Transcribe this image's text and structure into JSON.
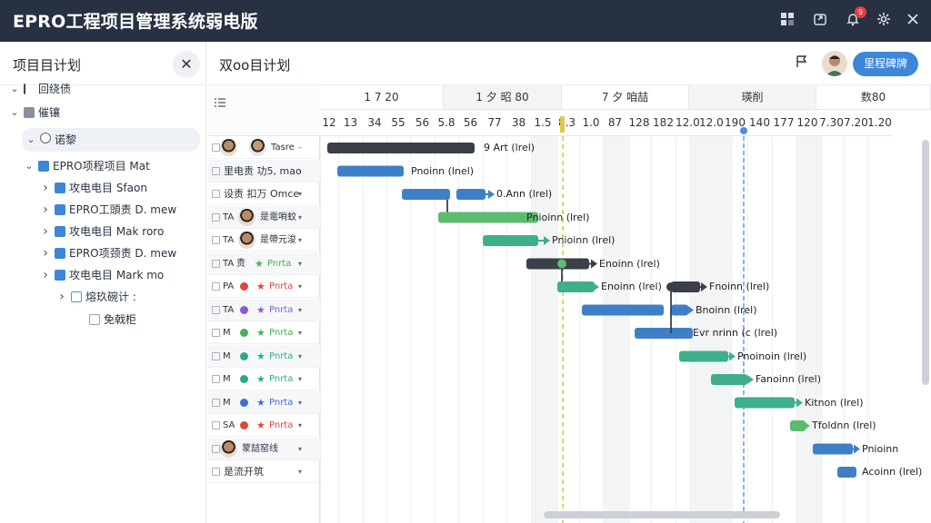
{
  "window": {
    "title": "EPRO工程项目管理系统弱电版",
    "icons": [
      "grid-icon",
      "share-icon",
      "bell-icon",
      "settings-icon",
      "close-icon"
    ],
    "notification_count": "9"
  },
  "left_panel": {
    "title": "项目目计划",
    "tree": [
      {
        "caret": "▾",
        "icon": "pin-icon",
        "label": "回绕债",
        "level": 0
      },
      {
        "caret": "▾",
        "icon": "square-icon",
        "label": "催镶",
        "level": 0
      },
      {
        "caret": "▾",
        "icon": "circle-icon",
        "label": "诺黎",
        "level": 1,
        "selected": true
      },
      {
        "caret": "▾",
        "icon": "project-icon",
        "label": "EPRO项程项目 Mat",
        "level": 2
      },
      {
        "caret": "›",
        "icon": "project-icon",
        "label": "攻电电目 Sfaon",
        "level": 3
      },
      {
        "caret": "›",
        "icon": "project-icon",
        "label": "EPRO工頭责 D. mew",
        "level": 3
      },
      {
        "caret": "›",
        "icon": "project-icon",
        "label": "攻电电目 Mak roro",
        "level": 3
      },
      {
        "caret": "›",
        "icon": "project-icon",
        "label": "EPRO项颈责 D. mew",
        "level": 3
      },
      {
        "caret": "›",
        "icon": "project-icon",
        "label": "攻电电目 Mark mo",
        "level": 3
      },
      {
        "caret": "›",
        "icon": "folder-icon",
        "label": "熔玖碗计 :",
        "level": 4
      },
      {
        "caret": "",
        "icon": "file-icon",
        "label": "免戟柜",
        "level": 5
      }
    ]
  },
  "main": {
    "title": "双oo目计划",
    "milestone_button": "里程碑牌",
    "timeline_top": [
      "1 7 20",
      "1 夕 昭 80",
      "7 夕 咱喆",
      "瑛削",
      "数80"
    ],
    "timeline_days": [
      "12",
      "13",
      "34",
      "55",
      "56",
      "5.8",
      "56",
      "77",
      "38",
      "1.5",
      "8.3",
      "1.0",
      "87",
      "128",
      "182",
      "12.0",
      "12.0",
      "190",
      "140",
      "177",
      "120",
      "7.30",
      "7.20",
      "1.20"
    ],
    "rows": [
      {
        "code": "",
        "name": "Tasre",
        "has_avatar": true
      },
      {
        "code": "",
        "name": "里电责 功5, mao",
        "has_avatar": false
      },
      {
        "code": "",
        "name": "设责 扣万 Omce",
        "has_avatar": false
      },
      {
        "code": "TA",
        "name": "是電哨蚊",
        "has_avatar": true
      },
      {
        "code": "TA",
        "name": "是帶元浚",
        "has_avatar": true
      },
      {
        "code": "TA",
        "name": "Pnrta",
        "prefix": "责",
        "mark": "green"
      },
      {
        "code": "PA",
        "name": "Pnrta",
        "mark": "red"
      },
      {
        "code": "TA",
        "name": "Pnrta",
        "mark": "purple"
      },
      {
        "code": "M",
        "name": "Pnrta",
        "mark": "green"
      },
      {
        "code": "M",
        "name": "Pnrta",
        "mark": "teal"
      },
      {
        "code": "M",
        "name": "Pnrta",
        "mark": "teal"
      },
      {
        "code": "M",
        "name": "Pnrta",
        "mark": "blue"
      },
      {
        "code": "SA",
        "name": "Pnrta",
        "mark": "red"
      },
      {
        "code": "",
        "name": "蒙喆窑线",
        "has_avatar": true
      },
      {
        "code": "",
        "name": "是流开筑",
        "has_avatar": false
      }
    ],
    "bar_labels": [
      "9 Art (lrel)",
      "Pnoinn (lnel)",
      "0.Ann (lrel)",
      "Pnioinn (lrel)",
      "Pnioinn (lrel)",
      "Enoinn (lrel)",
      "Enoinn (lrel)",
      "Fnoinn (lrel)",
      "Bnoinn (lrel)",
      "Evr nrinn (c (lrel)",
      "Pnoinoin (lrel)",
      "Fanoinn (lrel)",
      "Kitnon (lrel)",
      "Tfoldnn (lrel)",
      "Pnioinn",
      "Acoinn (lrel)"
    ]
  },
  "colors": {
    "titlebar": "#283142",
    "accent": "#3d86d8",
    "bar_dark": "#3a3f48",
    "bar_blue": "#3f7fc8",
    "bar_green": "#5cbb6e",
    "bar_teal": "#3fae8c",
    "today_line": "#4a8de0",
    "baseline": "#b6cf43"
  }
}
